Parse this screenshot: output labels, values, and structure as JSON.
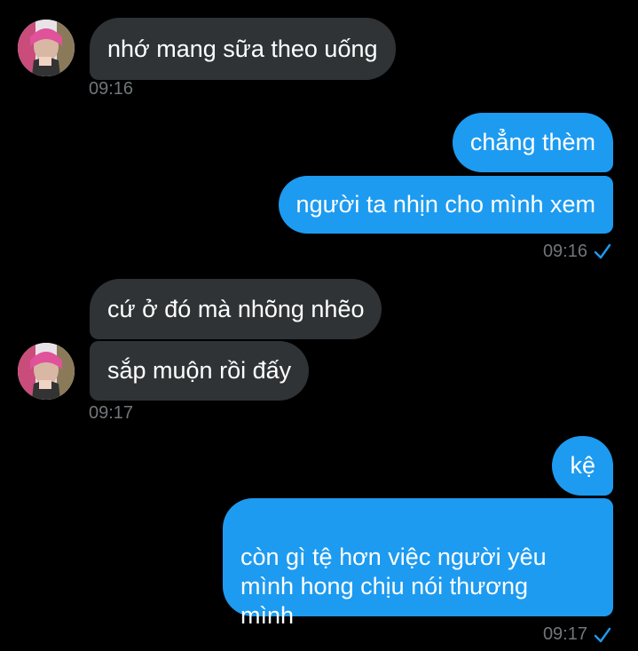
{
  "colors": {
    "background": "#000000",
    "incoming_bubble": "#2f3336",
    "outgoing_bubble": "#1d9bf0",
    "timestamp": "#71767b",
    "read_check": "#1d9bf0"
  },
  "messages": {
    "m1": {
      "text": "nhớ mang sữa theo uống",
      "direction": "incoming"
    },
    "t1": "09:16",
    "m2": {
      "text": "chẳng thèm",
      "direction": "outgoing"
    },
    "m3": {
      "text": "người ta nhịn cho mình xem",
      "direction": "outgoing"
    },
    "t2": "09:16",
    "m4": {
      "text": "cứ ở đó mà nhõng nhẽo",
      "direction": "incoming"
    },
    "m5": {
      "text": "sắp muộn rồi đấy",
      "direction": "incoming"
    },
    "t3": "09:17",
    "m6": {
      "text": "kệ",
      "direction": "outgoing"
    },
    "m7": {
      "text": "còn gì tệ hơn việc người yêu\nmình hong chịu nói thương\nmình",
      "direction": "outgoing"
    },
    "t4": "09:17"
  },
  "icons": {
    "avatar": "contact-avatar",
    "read_receipt": "checkmark-icon"
  }
}
